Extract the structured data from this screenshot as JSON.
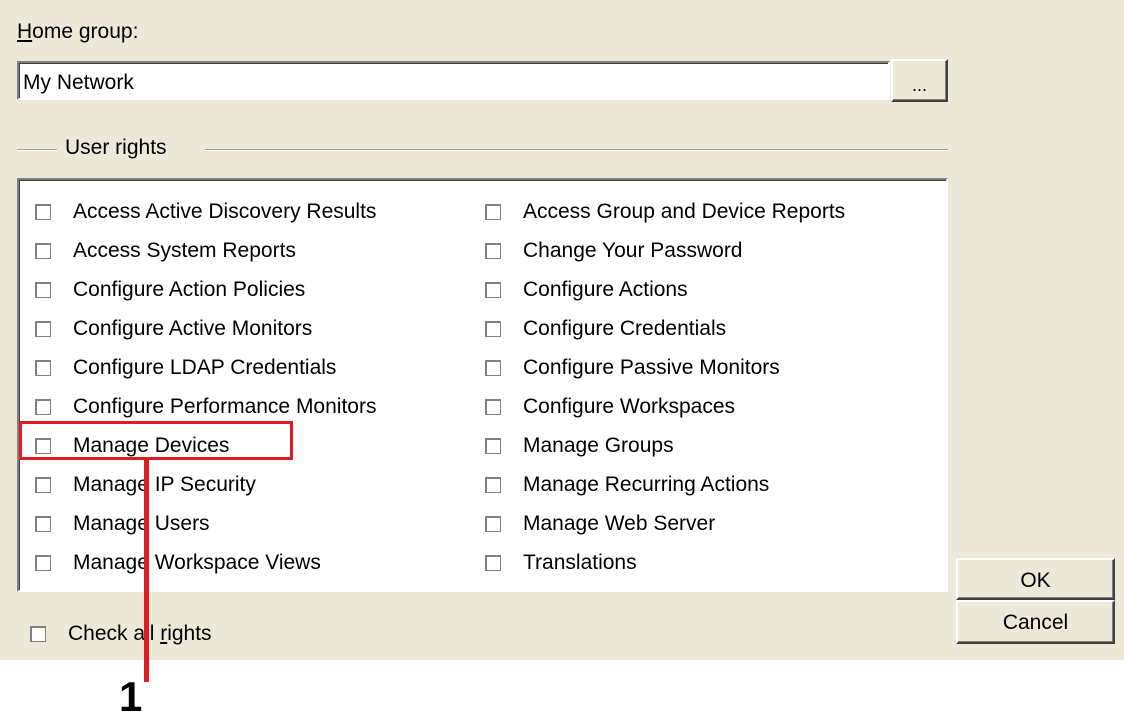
{
  "home_group": {
    "label_access_key": "H",
    "label_rest": "ome group:",
    "value": "My Network",
    "browse_label": "..."
  },
  "user_rights": {
    "group_label": "User rights",
    "left_column": [
      "Access Active Discovery Results",
      "Access System Reports",
      "Configure Action Policies",
      "Configure Active Monitors",
      "Configure LDAP Credentials",
      "Configure Performance Monitors",
      "Manage Devices",
      "Manage IP Security",
      "Manage Users",
      "Manage Workspace Views"
    ],
    "right_column": [
      "Access Group and Device Reports",
      "Change Your Password",
      "Configure Actions",
      "Configure Credentials",
      "Configure Passive Monitors",
      "Configure Workspaces",
      "Manage Groups",
      "Manage Recurring Actions",
      "Manage Web Server",
      "Translations"
    ]
  },
  "check_all": {
    "label_before": "Check all ",
    "label_access_key": "r",
    "label_after": "ights"
  },
  "buttons": {
    "ok": "OK",
    "cancel": "Cancel"
  },
  "callout": {
    "number": "1",
    "color": "#e11b22"
  }
}
